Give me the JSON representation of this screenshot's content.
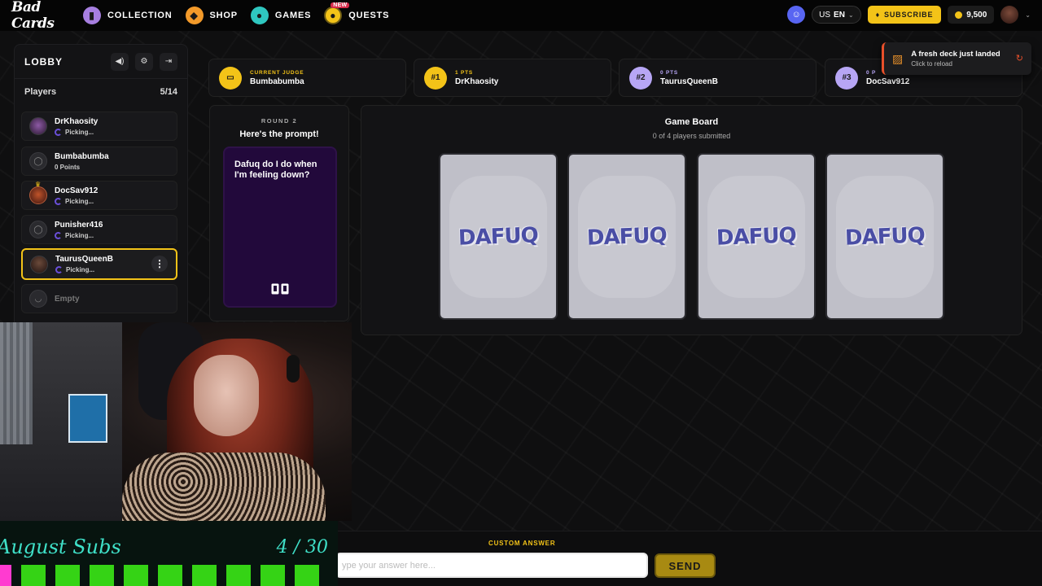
{
  "nav": {
    "logo": "Bad Cards",
    "collection": "COLLECTION",
    "shop": "SHOP",
    "games": "GAMES",
    "quests": "QUESTS",
    "new_badge": "NEW",
    "lang_country": "US",
    "lang_code": "EN",
    "subscribe": "SUBSCRIBE",
    "coins": "9,500"
  },
  "lobby": {
    "title": "LOBBY",
    "players_label": "Players",
    "players_count": "5/14",
    "players": [
      {
        "name": "DrKhaosity",
        "status": "Picking..."
      },
      {
        "name": "Bumbabumba",
        "status": "0 Points"
      },
      {
        "name": "DocSav912",
        "status": "Picking..."
      },
      {
        "name": "Punisher416",
        "status": "Picking..."
      },
      {
        "name": "TaurusQueenB",
        "status": "Picking..."
      },
      {
        "name": "Empty",
        "status": ""
      }
    ]
  },
  "scores": [
    {
      "badge": "",
      "label": "CURRENT JUDGE",
      "name": "Bumbabumba"
    },
    {
      "badge": "#1",
      "label": "1 PTS",
      "name": "DrKhaosity"
    },
    {
      "badge": "#2",
      "label": "0 PTS",
      "name": "TaurusQueenB"
    },
    {
      "badge": "#3",
      "label": "0 P",
      "name": "DocSav912"
    }
  ],
  "toast": {
    "title": "A fresh deck just landed",
    "subtitle": "Click to reload"
  },
  "prompt": {
    "round": "ROUND 2",
    "header": "Here's the prompt!",
    "text": "Dafuq do I do when I'm feeling down?"
  },
  "board": {
    "title": "Game Board",
    "subtitle": "0 of 4 players submitted",
    "card_label": "DAFUQ"
  },
  "subs": {
    "title": "August Subs",
    "count": "4 / 30"
  },
  "answer": {
    "label": "CUSTOM ANSWER",
    "placeholder": "ype your answer here...",
    "send": "SEND"
  },
  "colors": {
    "accent": "#f3c318",
    "purple": "#b7a6f5",
    "prompt_card": "#22093b",
    "sub_cell": "#35d315"
  }
}
